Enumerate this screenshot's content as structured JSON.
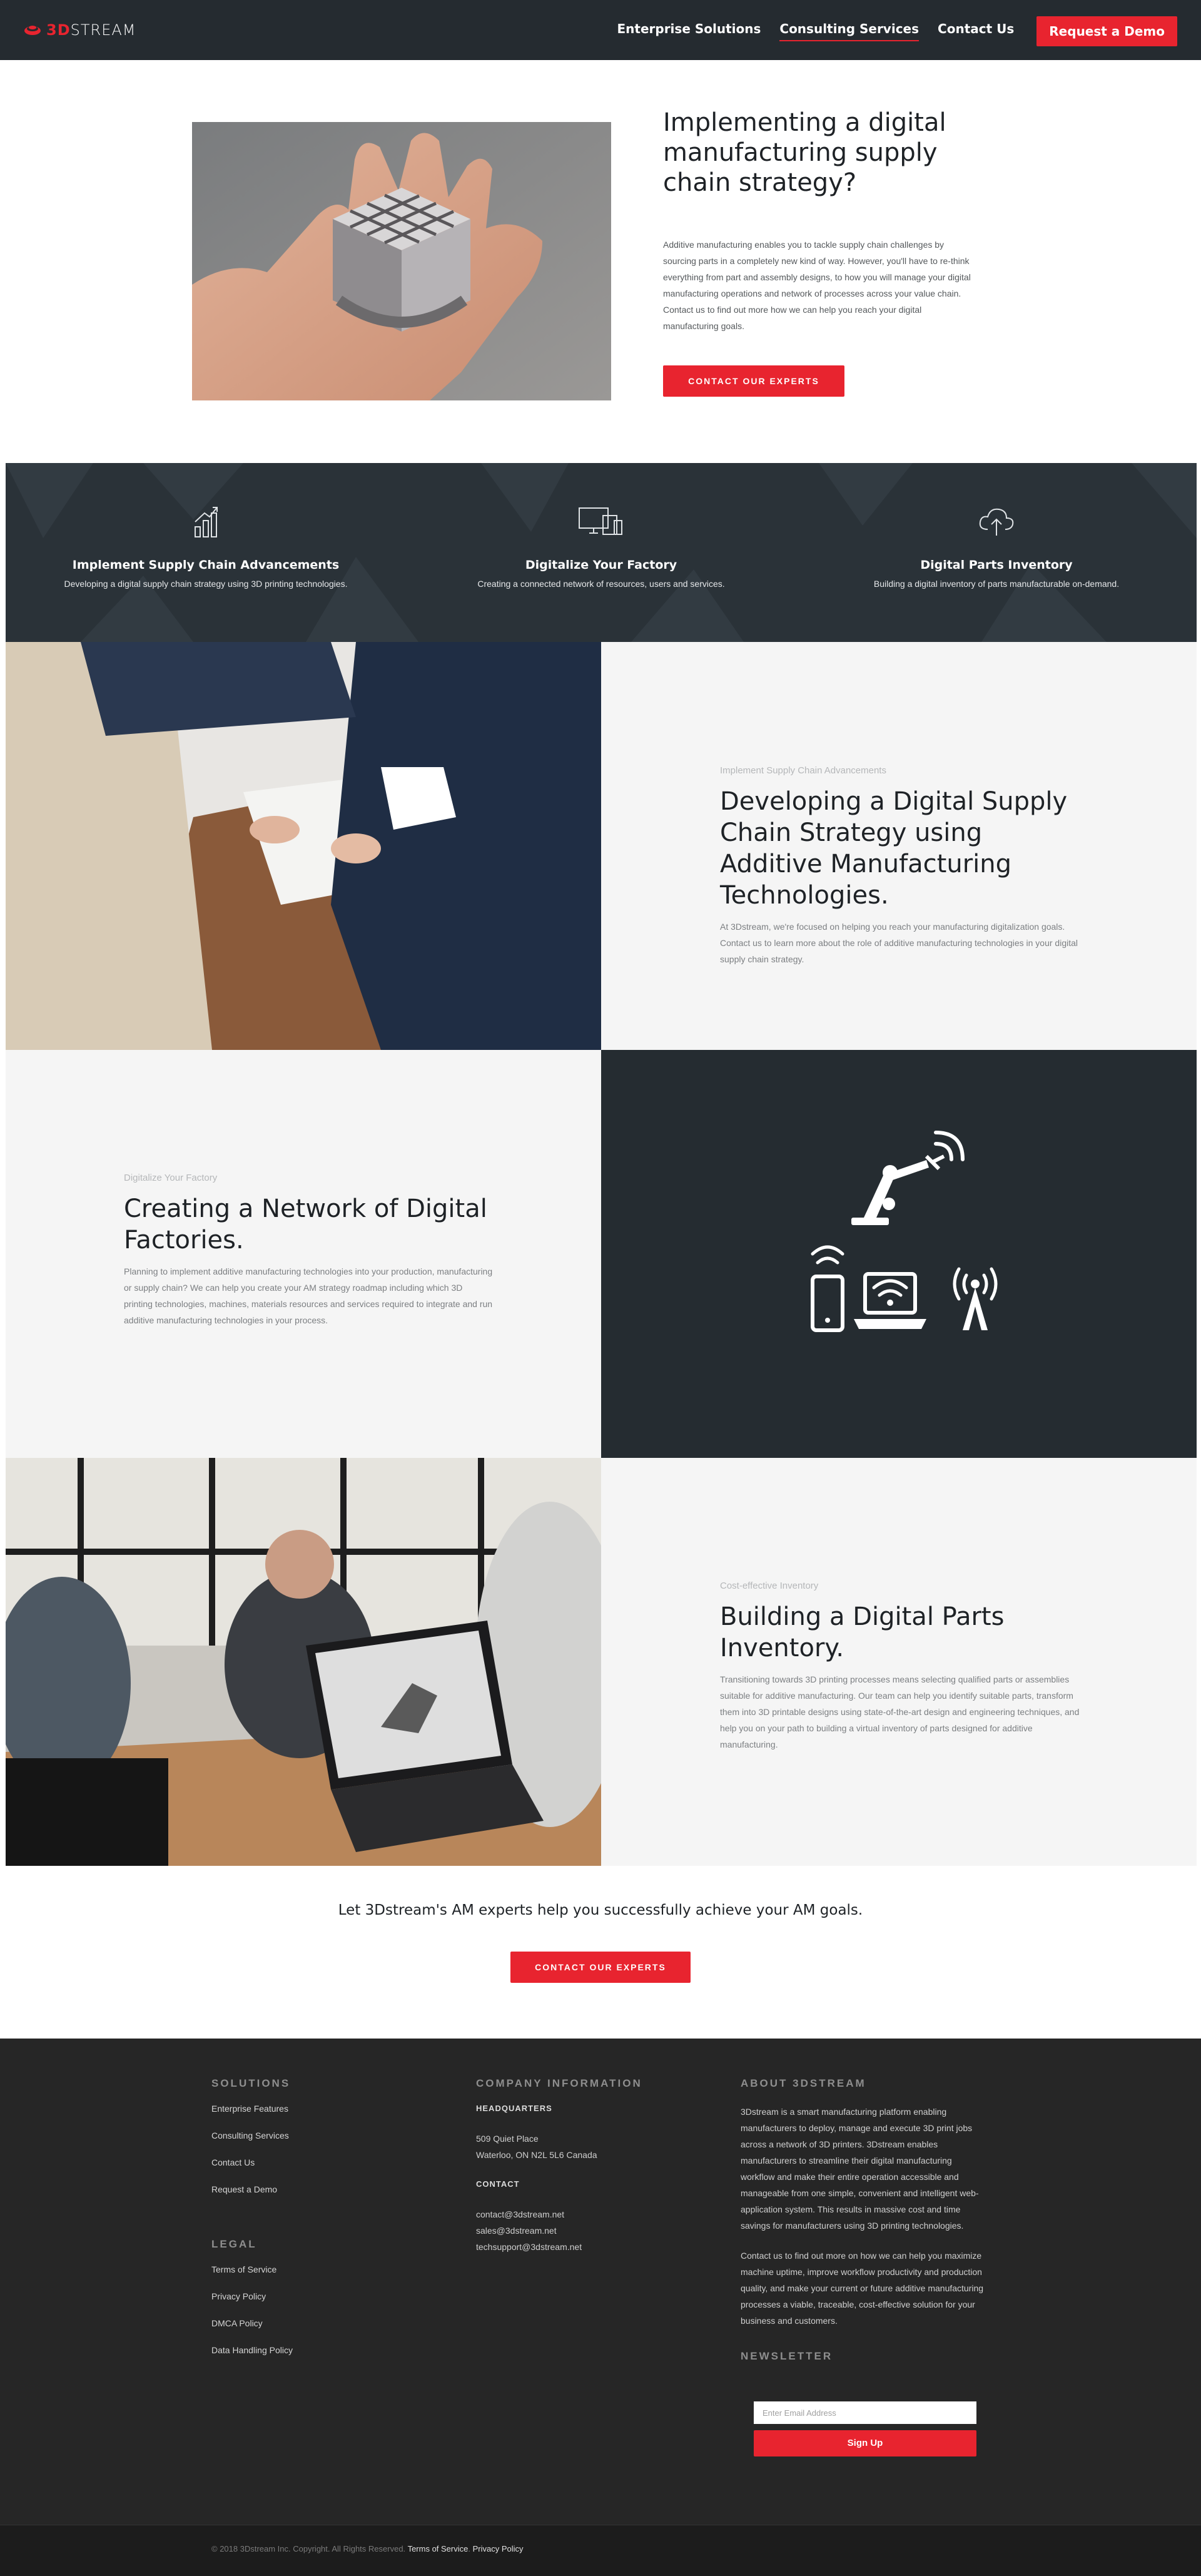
{
  "nav": {
    "logo_number": "3D",
    "logo_word": "STREAM",
    "links": [
      "Enterprise Solutions",
      "Consulting Services",
      "Contact Us"
    ],
    "active_link": "Consulting Services",
    "cta": "Request a Demo",
    "colors": {
      "background": "#252b30",
      "accent": "#e8242f"
    }
  },
  "hero": {
    "title": "Implementing a digital manufacturing supply chain strategy?",
    "text": "Additive manufacturing enables you to tackle supply chain challenges by sourcing parts in a completely new kind of way. However, you'll have to re-think everything from part and assembly designs, to how you will manage your digital manufacturing operations and network of processes across your value chain. Contact us to find out more how we can help you reach your digital manufacturing goals.",
    "button": "CONTACT OUR EXPERTS"
  },
  "features": [
    {
      "icon": "bar-chart-icon",
      "title": "Implement Supply Chain Advancements",
      "text": "Developing a digital supply chain strategy using 3D printing technologies."
    },
    {
      "icon": "devices-icon",
      "title": "Digitalize Your Factory",
      "text": "Creating a connected network of resources, users and services."
    },
    {
      "icon": "cloud-upload-icon",
      "title": "Digital Parts Inventory",
      "text": "Building a digital inventory of parts manufacturable on-demand."
    }
  ],
  "sections": [
    {
      "kicker": "Implement Supply Chain Advancements",
      "title": "Developing a Digital Supply Chain Strategy using Additive Manufacturing Technologies.",
      "text": "At 3Dstream, we're focused on helping you reach your manufacturing digitalization goals. Contact us to learn more about the role of additive manufacturing technologies in your digital supply chain strategy."
    },
    {
      "kicker": "Digitalize Your Factory",
      "title": "Creating a Network of Digital Factories.",
      "text": "Planning to implement additive manufacturing technologies into your production, manufacturing or supply chain? We can help you create your AM strategy roadmap including which 3D printing technologies, machines, materials resources and services required to integrate and run additive manufacturing technologies in your process."
    },
    {
      "kicker": "Cost-effective Inventory",
      "title": "Building a Digital Parts Inventory.",
      "text": "Transitioning towards 3D printing processes means selecting qualified parts or assemblies suitable for additive manufacturing. Our team can help you identify suitable parts, transform them into 3D printable designs using state-of-the-art design and engineering techniques, and help you on your path to building a virtual inventory of parts designed for additive manufacturing."
    }
  ],
  "cta": {
    "text": "Let 3Dstream's AM experts help you successfully achieve your AM goals.",
    "button": "CONTACT OUR EXPERTS"
  },
  "footer": {
    "solutions": {
      "heading": "SOLUTIONS",
      "links": [
        "Enterprise Features",
        "Consulting Services",
        "Contact Us",
        "Request a Demo"
      ]
    },
    "legal": {
      "heading": "LEGAL",
      "links": [
        "Terms of Service",
        "Privacy Policy",
        "DMCA Policy",
        "Data Handling Policy"
      ]
    },
    "company": {
      "heading": "COMPANY INFORMATION",
      "hq_label": "HEADQUARTERS",
      "address_1": "509 Quiet Place",
      "address_2": "Waterloo, ON N2L 5L6 Canada",
      "contact_label": "CONTACT",
      "emails": [
        "contact@3dstream.net",
        "sales@3dstream.net",
        "techsupport@3dstream.net"
      ]
    },
    "about": {
      "heading": "ABOUT 3DSTREAM",
      "text_1": "3Dstream is a smart manufacturing platform enabling manufacturers to deploy, manage and execute 3D print jobs across a network of 3D printers. 3Dstream enables manufacturers to streamline their digital manufacturing workflow and make their entire operation accessible and manageable from one simple, convenient and intelligent web-application system. This results in massive cost and time savings for manufacturers using 3D printing technologies.",
      "text_2": "Contact us to find out more on how we can help you maximize machine uptime, improve workflow productivity and production quality, and make your current or future additive manufacturing processes a viable, traceable, cost-effective solution for your business and customers."
    },
    "newsletter": {
      "heading": "NEWSLETTER",
      "placeholder": "Enter Email Address",
      "button": "Sign Up"
    },
    "copyright": "© 2018 3Dstream Inc. Copyright. All Rights Reserved.",
    "terms": "Terms of Service",
    "privacy": "Privacy Policy"
  }
}
